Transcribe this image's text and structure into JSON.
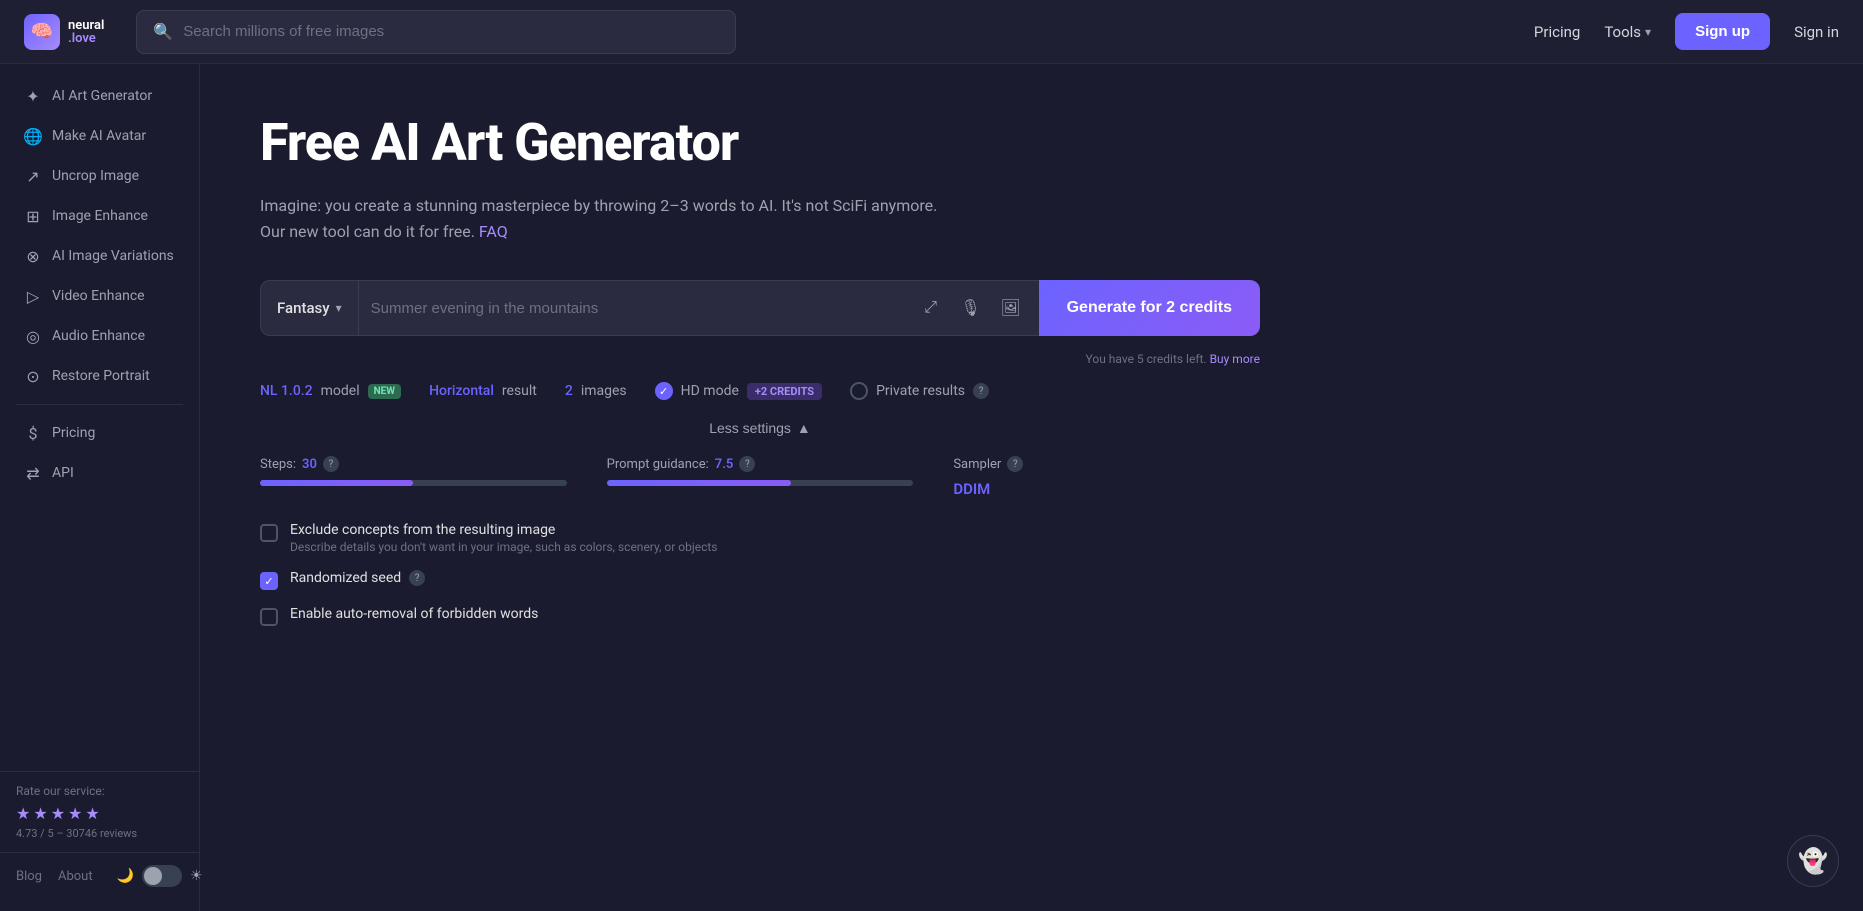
{
  "header": {
    "logo_line1": "neural",
    "logo_line2": ".love",
    "search_placeholder": "Search millions of free images",
    "pricing_label": "Pricing",
    "tools_label": "Tools",
    "signup_label": "Sign up",
    "signin_label": "Sign in"
  },
  "sidebar": {
    "items": [
      {
        "id": "ai-art-generator",
        "label": "AI Art Generator",
        "icon": "✦"
      },
      {
        "id": "make-ai-avatar",
        "label": "Make AI Avatar",
        "icon": "🌐"
      },
      {
        "id": "uncrop-image",
        "label": "Uncrop Image",
        "icon": "↗"
      },
      {
        "id": "image-enhance",
        "label": "Image Enhance",
        "icon": "⊞"
      },
      {
        "id": "ai-image-variations",
        "label": "AI Image Variations",
        "icon": "⊗"
      },
      {
        "id": "video-enhance",
        "label": "Video Enhance",
        "icon": "▷"
      },
      {
        "id": "audio-enhance",
        "label": "Audio Enhance",
        "icon": "◎"
      },
      {
        "id": "restore-portrait",
        "label": "Restore Portrait",
        "icon": "⊙"
      }
    ],
    "separator_items": [
      {
        "id": "pricing",
        "label": "Pricing",
        "icon": "$"
      },
      {
        "id": "api",
        "label": "API",
        "icon": "⇄"
      }
    ],
    "rating": {
      "label": "Rate our service:",
      "stars": 5,
      "text": "4.73 / 5 – 30746 reviews"
    }
  },
  "main": {
    "title": "Free AI Art Generator",
    "description_1": "Imagine: you create a stunning masterpiece by throwing 2–3 words to AI. It's not SciFi anymore.",
    "description_2": "Our new tool can do it for free.",
    "faq_label": "FAQ",
    "style_selector": "Fantasy",
    "prompt_placeholder": "Summer evening in the mountains",
    "generate_btn": "Generate for 2 credits",
    "credits_hint": "You have 5 credits left. Buy more",
    "credits_link_text": "Buy more",
    "settings": {
      "model_label": "model",
      "model_value": "NL 1.0.2",
      "model_badge": "NEW",
      "result_label": "result",
      "result_value": "Horizontal",
      "images_label": "images",
      "images_value": "2",
      "hd_label": "HD mode",
      "hd_badge": "+2 CREDITS",
      "private_label": "Private results"
    },
    "less_settings_btn": "Less settings",
    "advanced": {
      "steps_label": "Steps:",
      "steps_value": "30",
      "steps_fill_pct": 50,
      "guidance_label": "Prompt guidance:",
      "guidance_value": "7.5",
      "guidance_fill_pct": 60,
      "sampler_label": "Sampler",
      "sampler_value": "DDIM"
    },
    "checkboxes": [
      {
        "id": "exclude-concepts",
        "checked": false,
        "label": "Exclude concepts from the resulting image",
        "sublabel": "Describe details you don't want in your image, such as colors, scenery, or objects"
      },
      {
        "id": "randomized-seed",
        "checked": true,
        "label": "Randomized seed",
        "sublabel": ""
      },
      {
        "id": "auto-removal",
        "checked": false,
        "label": "Enable auto-removal of forbidden words",
        "sublabel": ""
      }
    ]
  },
  "bottom": {
    "blog_label": "Blog",
    "about_label": "About"
  }
}
